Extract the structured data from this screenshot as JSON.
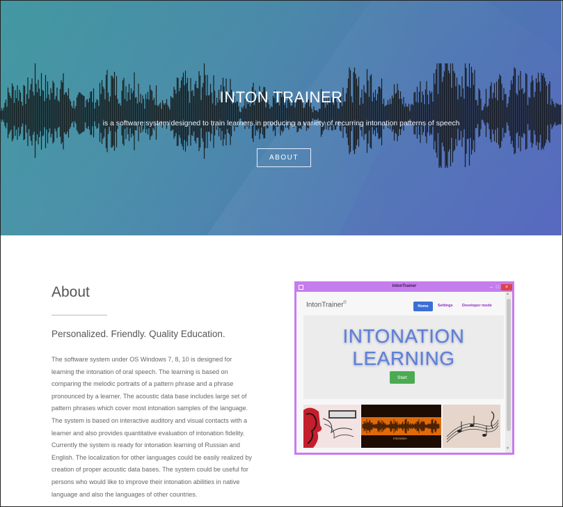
{
  "hero": {
    "title": "INTON TRAINER",
    "subtitle": "is a software system designed to train learners in producing a variety of recurring intonation patterns of speech",
    "button_label": "ABOUT",
    "colors": {
      "gradient_start": "#3f8f9f",
      "gradient_end": "#5566bf",
      "waveform": "#111111"
    }
  },
  "about": {
    "heading": "About",
    "tagline": "Personalized. Friendly. Quality Education.",
    "body_lines": [
      "The software system under OS Windows 7, 8, 10 is designed for",
      "learning the intonation of oral speech. The learning is based on",
      "comparing the melodic portraits of a pattern phrase and a phrase",
      "pronounced by a learner. The acoustic data base includes large set of",
      "pattern phrases which cover most intonation samples of the language.",
      "The system is based on interactive auditory and visual contacts with a",
      "learner and also provides quantitative evaluation of intonation fidelity.",
      "Currently the system is ready for intonation learning of Russian and",
      "English. The localization for other languages could be easily realized by",
      "creation of proper acoustic data bases. The system could be useful for",
      "persons who would like to improve their intonation abilities in native",
      "language and also the languages of other countries."
    ]
  },
  "app_window": {
    "window_title": "IntonTrainer",
    "min_glyph": "–",
    "max_glyph": "□",
    "close_glyph": "×",
    "brand": "IntonTrainer",
    "brand_mark": "©",
    "nav": {
      "home": "Home",
      "settings": "Settings",
      "developer": "Developer mode"
    },
    "hero_line1": "INTONATION",
    "hero_line2": "LEARNING",
    "start_label": "Start",
    "thumb2_caption": "Intonation",
    "scroll_up": "▲",
    "scroll_down": "▼",
    "colors": {
      "border": "#c87bf0",
      "titlebar": "#c47ded",
      "home_btn": "#3b6fd6",
      "start_btn": "#4cab52",
      "nav_link": "#8a2fbf"
    },
    "icons": [
      "window-app-icon",
      "minimize-icon",
      "maximize-icon",
      "close-icon"
    ]
  }
}
